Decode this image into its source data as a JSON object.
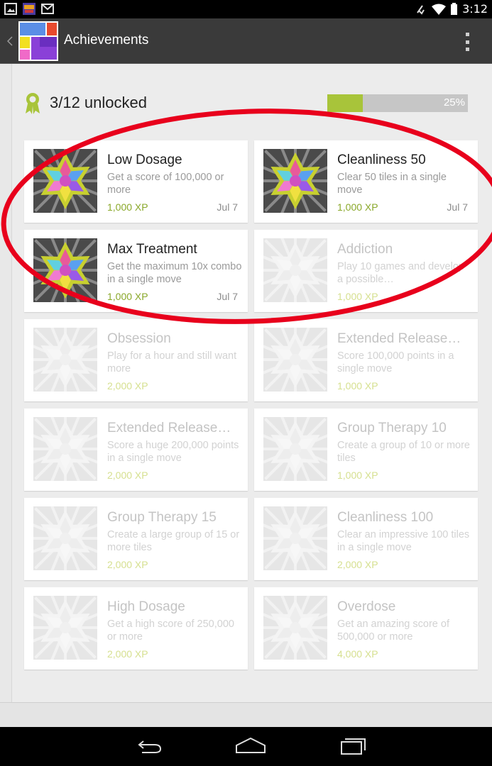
{
  "status_bar": {
    "time": "3:12",
    "left_icons": [
      "image-icon",
      "game-icon",
      "gmail-icon"
    ],
    "right_icons": [
      "mute-icon",
      "wifi-icon",
      "battery-icon"
    ]
  },
  "action_bar": {
    "title": "Achievements",
    "back_icon": "chevron-left-icon",
    "overflow_icon": "overflow-menu-icon"
  },
  "summary": {
    "unlocked_text": "3/12 unlocked",
    "progress_label": "25%",
    "progress_fraction": 0.25,
    "icon": "ribbon-icon"
  },
  "colors": {
    "xp_green": "#8aa82a",
    "progress_fill": "#a8c43a",
    "annotation_red": "#e8001c"
  },
  "achievements": [
    {
      "title": "Low Dosage",
      "description": "Get a score of 100,000 or more",
      "xp": "1,000 XP",
      "date": "Jul 7",
      "unlocked": true
    },
    {
      "title": "Cleanliness 50",
      "description": "Clear 50 tiles in a single move",
      "xp": "1,000 XP",
      "date": "Jul 7",
      "unlocked": true
    },
    {
      "title": "Max Treatment",
      "description": "Get the maximum 10x combo in a single move",
      "xp": "1,000 XP",
      "date": "Jul 7",
      "unlocked": true
    },
    {
      "title": "Addiction",
      "description": "Play 10 games and develop a possible…",
      "xp": "1,000 XP",
      "date": "",
      "unlocked": false
    },
    {
      "title": "Obsession",
      "description": "Play for a hour and still want more",
      "xp": "2,000 XP",
      "date": "",
      "unlocked": false
    },
    {
      "title": "Extended Release…",
      "description": "Score 100,000 points in a single move",
      "xp": "1,000 XP",
      "date": "",
      "unlocked": false
    },
    {
      "title": "Extended Release…",
      "description": "Score a huge 200,000 points in a single move",
      "xp": "2,000 XP",
      "date": "",
      "unlocked": false
    },
    {
      "title": "Group Therapy 10",
      "description": "Create a group of 10 or more tiles",
      "xp": "1,000 XP",
      "date": "",
      "unlocked": false
    },
    {
      "title": "Group Therapy 15",
      "description": "Create a large group of 15 or more tiles",
      "xp": "2,000 XP",
      "date": "",
      "unlocked": false
    },
    {
      "title": "Cleanliness 100",
      "description": "Clear an impressive 100 tiles in a single move",
      "xp": "2,000 XP",
      "date": "",
      "unlocked": false
    },
    {
      "title": "High Dosage",
      "description": "Get a high score of 250,000 or more",
      "xp": "2,000 XP",
      "date": "",
      "unlocked": false
    },
    {
      "title": "Overdose",
      "description": "Get an amazing score of 500,000 or more",
      "xp": "4,000 XP",
      "date": "",
      "unlocked": false
    }
  ],
  "nav_bar": {
    "buttons": [
      "back-icon",
      "home-icon",
      "recent-apps-icon"
    ]
  }
}
